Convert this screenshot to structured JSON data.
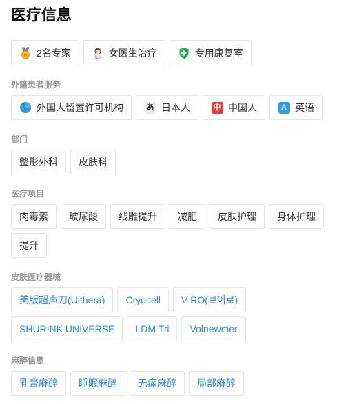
{
  "page_title": "医疗信息",
  "highlights": [
    {
      "icon": "medal-icon",
      "label": "2名专家"
    },
    {
      "icon": "female-doctor-icon",
      "label": "女医生治疗"
    },
    {
      "icon": "shield-icon",
      "label": "专用康复室"
    }
  ],
  "foreign_services": {
    "title": "外籍患者服务",
    "items": [
      {
        "icon": "globe-icon",
        "label": "外国人留置许可机构"
      },
      {
        "icon": "japanese-icon",
        "glyph": "あ",
        "label": "日本人"
      },
      {
        "icon": "chinese-icon",
        "glyph": "中",
        "label": "中国人"
      },
      {
        "icon": "english-icon",
        "glyph": "A",
        "label": "英语"
      }
    ]
  },
  "departments": {
    "title": "部门",
    "items": [
      "整形外科",
      "皮肤科"
    ]
  },
  "treatments": {
    "title": "医疗项目",
    "items": [
      "肉毒素",
      "玻尿酸",
      "线雕提升",
      "减肥",
      "皮肤护理",
      "身体护理",
      "提升"
    ]
  },
  "devices": {
    "title": "皮肤医疗器械",
    "items": [
      "美版超声刀(Ulthera)",
      "Cryocell",
      "V-RO(브이로)",
      "SHURINK UNIVERSE",
      "LDM Tri",
      "Volnewmer"
    ]
  },
  "anesthesia": {
    "title": "麻醉信息",
    "items": [
      "乳膏麻醉",
      "睡眠麻醉",
      "无痛麻醉",
      "局部麻醉"
    ]
  },
  "colors": {
    "accent": "#2b8de6",
    "section_label": "#999999",
    "chip_border": "#e6e6e6",
    "chip_text": "#333333",
    "title": "#111111"
  }
}
